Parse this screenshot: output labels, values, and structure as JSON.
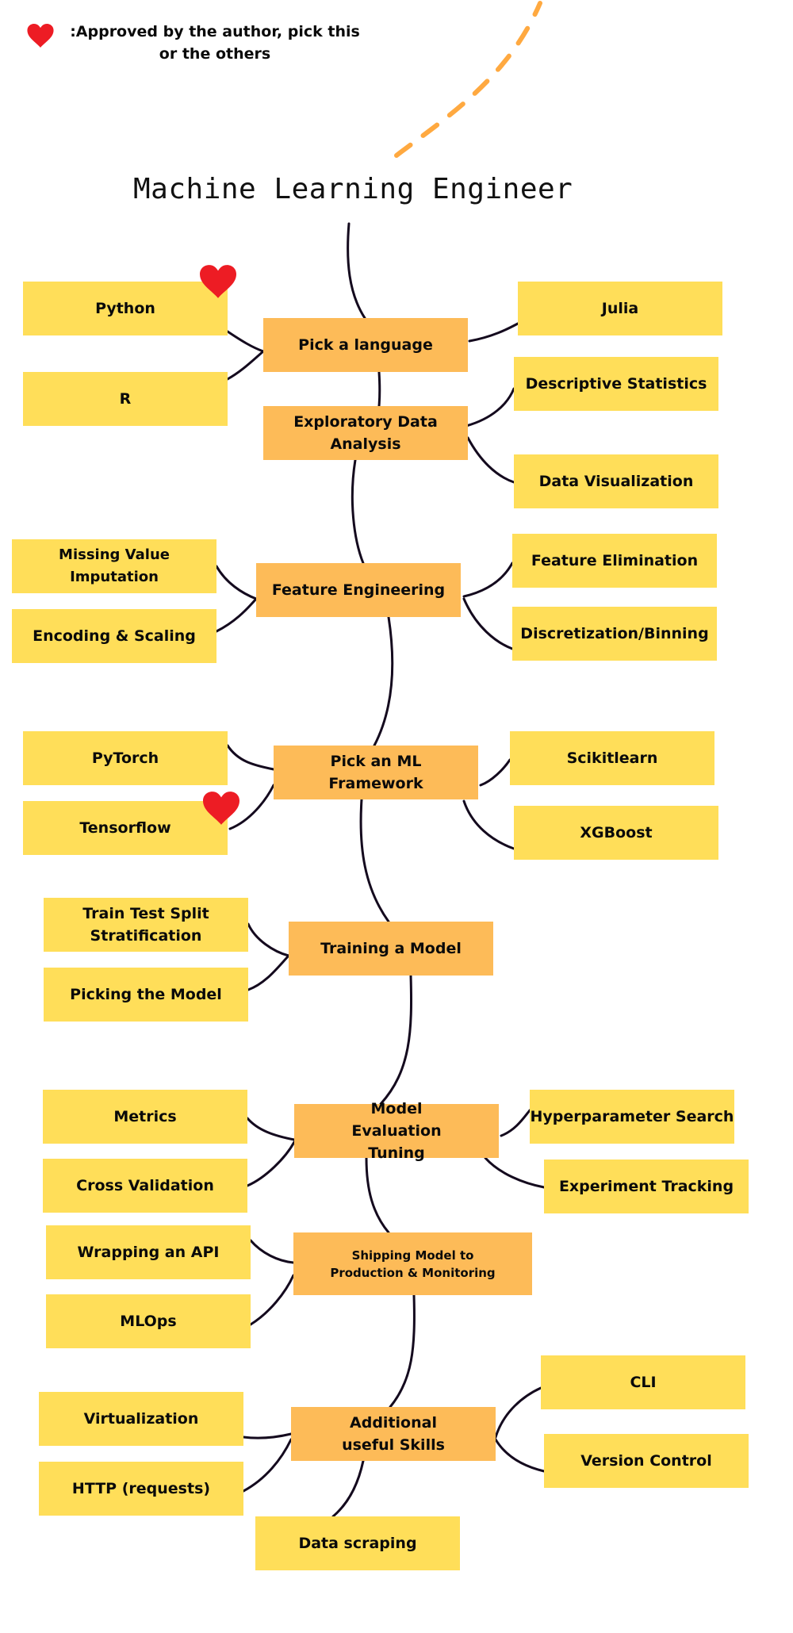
{
  "legend": {
    "icon": "heart-icon",
    "text": ":Approved by the author, pick this or the others"
  },
  "title": "Machine Learning Engineer",
  "colors": {
    "step": "#FDBB58",
    "leaf": "#FFDE59",
    "heart": "#ED1C24",
    "connector": "#140A1E",
    "dashed_accent": "#FFA940"
  },
  "steps": [
    {
      "id": "pick-language",
      "label": "Pick a language",
      "left": [
        {
          "label": "Python",
          "approved": true
        },
        {
          "label": "R"
        }
      ],
      "right": [
        {
          "label": "Julia"
        }
      ]
    },
    {
      "id": "eda",
      "label": "Exploratory Data Analysis",
      "left": [],
      "right": [
        {
          "label": "Descriptive Statistics"
        },
        {
          "label": "Data Visualization"
        }
      ]
    },
    {
      "id": "feature-engineering",
      "label": "Feature Engineering",
      "left": [
        {
          "label": "Missing Value Imputation"
        },
        {
          "label": "Encoding & Scaling"
        }
      ],
      "right": [
        {
          "label": "Feature Elimination"
        },
        {
          "label": "Discretization/Binning"
        }
      ]
    },
    {
      "id": "pick-ml-framework",
      "label": "Pick an ML Framework",
      "left": [
        {
          "label": "PyTorch"
        },
        {
          "label": "Tensorflow",
          "approved": true
        }
      ],
      "right": [
        {
          "label": "Scikitlearn"
        },
        {
          "label": "XGBoost"
        }
      ]
    },
    {
      "id": "training-model",
      "label": "Training a Model",
      "left": [
        {
          "label": "Train Test Split Stratification"
        },
        {
          "label": "Picking the Model"
        }
      ],
      "right": []
    },
    {
      "id": "model-evaluation",
      "label": "Model Evaluation Tuning",
      "left": [
        {
          "label": "Metrics"
        },
        {
          "label": "Cross Validation"
        }
      ],
      "right": [
        {
          "label": "Hyperparameter Search"
        },
        {
          "label": "Experiment Tracking"
        }
      ]
    },
    {
      "id": "shipping",
      "label": "Shipping Model to Production & Monitoring",
      "left": [
        {
          "label": "Wrapping an API"
        },
        {
          "label": "MLOps"
        }
      ],
      "right": []
    },
    {
      "id": "additional-skills",
      "label": "Additional useful Skills",
      "left": [
        {
          "label": "Virtualization"
        },
        {
          "label": "HTTP (requests)"
        }
      ],
      "right": [
        {
          "label": "CLI"
        },
        {
          "label": "Version Control"
        }
      ],
      "below": [
        {
          "label": "Data scraping"
        }
      ]
    }
  ]
}
